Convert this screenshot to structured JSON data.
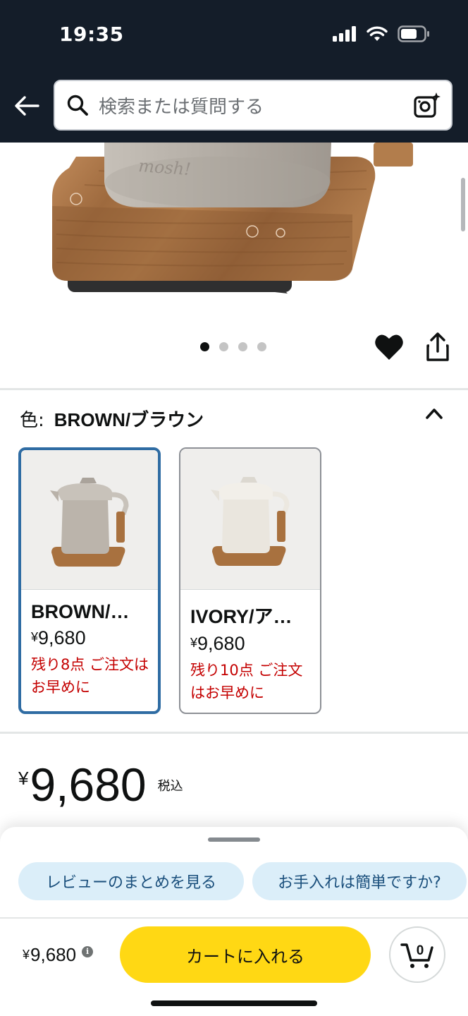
{
  "status_bar": {
    "time": "19:35"
  },
  "header": {
    "search_placeholder": "検索または質問する",
    "back_icon": "arrow-left-icon",
    "camera_icon": "camera-sparkle-icon"
  },
  "hero": {
    "brand_text": "mosh!",
    "dots": 4,
    "active_dot": 0
  },
  "variation": {
    "label": "色:",
    "selected_value": "BROWN/ブラウン",
    "options": [
      {
        "name": "BROWN/…",
        "currency": "¥",
        "price": "9,680",
        "stock": "残り8点 ご注文はお早めに",
        "selected": true
      },
      {
        "name": "IVORY/ア…",
        "currency": "¥",
        "price": "9,680",
        "stock": "残り10点 ご注文はお早めに",
        "selected": false
      }
    ]
  },
  "price": {
    "currency": "¥",
    "amount": "9,680",
    "tax_label": "税込"
  },
  "sheet": {
    "chips": [
      "レビューのまとめを見る",
      "お手入れは簡単ですか?"
    ],
    "price_currency": "¥",
    "price_amount": "9,680",
    "cart_button": "カートに入れる",
    "cart_count": "0"
  },
  "colors": {
    "header_bg": "#141d29",
    "cart_button": "#ffd814",
    "chip_bg": "#dbeef9",
    "selected_border": "#2f6ca3",
    "stock_red": "#c40000"
  }
}
